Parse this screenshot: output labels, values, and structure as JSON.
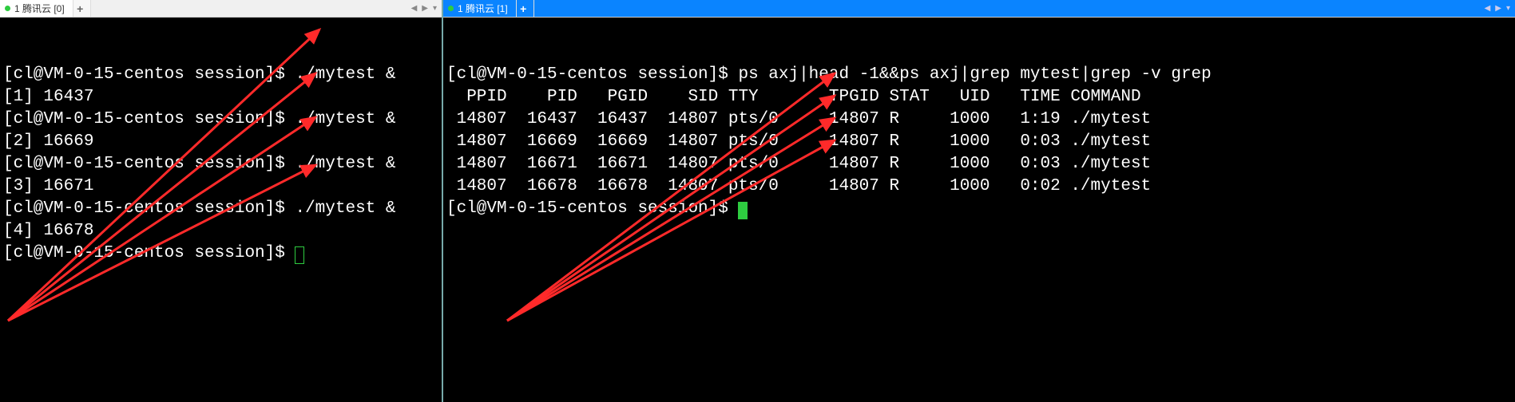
{
  "panes": {
    "left": {
      "tab": {
        "indicator": "green",
        "label": "1 腾讯云 [0]"
      },
      "addTab": "+",
      "prompt": "[cl@VM-0-15-centos session]$ ",
      "commands": [
        {
          "cmd": "./mytest &",
          "response": "[1] 16437"
        },
        {
          "cmd": "./mytest &",
          "response": "[2] 16669"
        },
        {
          "cmd": "./mytest &",
          "response": "[3] 16671"
        },
        {
          "cmd": "./mytest &",
          "response": "[4] 16678"
        }
      ]
    },
    "right": {
      "tab": {
        "indicator": "green",
        "label": "1 腾讯云 [1]"
      },
      "addTab": "+",
      "prompt": "[cl@VM-0-15-centos session]$ ",
      "command": "ps axj|head -1&&ps axj|grep mytest|grep -v grep",
      "header": "  PPID    PID   PGID    SID TTY       TPGID STAT   UID   TIME COMMAND",
      "rows": [
        {
          "PPID": "14807",
          "PID": "16437",
          "PGID": "16437",
          "SID": "14807",
          "TTY": "pts/0",
          "TPGID": "14807",
          "STAT": "R",
          "UID": "1000",
          "TIME": "1:19",
          "COMMAND": "./mytest"
        },
        {
          "PPID": "14807",
          "PID": "16669",
          "PGID": "16669",
          "SID": "14807",
          "TTY": "pts/0",
          "TPGID": "14807",
          "STAT": "R",
          "UID": "1000",
          "TIME": "0:03",
          "COMMAND": "./mytest"
        },
        {
          "PPID": "14807",
          "PID": "16671",
          "PGID": "16671",
          "SID": "14807",
          "TTY": "pts/0",
          "TPGID": "14807",
          "STAT": "R",
          "UID": "1000",
          "TIME": "0:03",
          "COMMAND": "./mytest"
        },
        {
          "PPID": "14807",
          "PID": "16678",
          "PGID": "16678",
          "SID": "14807",
          "TTY": "pts/0",
          "TPGID": "14807",
          "STAT": "R",
          "UID": "1000",
          "TIME": "0:02",
          "COMMAND": "./mytest"
        }
      ]
    }
  },
  "tabbar_controls": {
    "left_arrow": "◀",
    "right_arrow": "▶",
    "menu": "▾"
  }
}
